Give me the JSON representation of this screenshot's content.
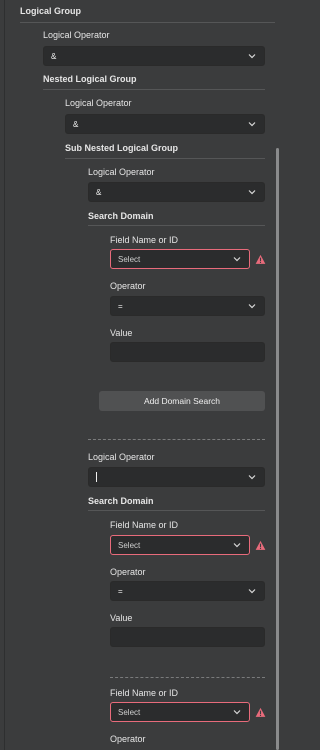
{
  "root": {
    "title": "Logical Group",
    "operator_label": "Logical Operator",
    "operator_value": "&"
  },
  "nested": {
    "title": "Nested Logical Group",
    "operator_label": "Logical Operator",
    "operator_value": "&"
  },
  "sub_nested": {
    "title": "Sub Nested Logical Group",
    "operator_label": "Logical Operator",
    "operator_value": "&",
    "search_domain_title": "Search Domain",
    "domain": {
      "field_label": "Field Name or ID",
      "field_placeholder": "Select",
      "operator_label": "Operator",
      "operator_value": "=",
      "value_label": "Value",
      "value": ""
    },
    "add_button": "Add Domain Search"
  },
  "second_group": {
    "operator_label": "Logical Operator",
    "operator_value": "",
    "search_domain_title": "Search Domain",
    "domain": {
      "field_label": "Field Name or ID",
      "field_placeholder": "Select",
      "operator_label": "Operator",
      "operator_value": "=",
      "value_label": "Value",
      "value": ""
    },
    "domain2": {
      "field_label": "Field Name or ID",
      "field_placeholder": "Select",
      "operator_label": "Operator"
    }
  },
  "colors": {
    "error": "#e86b7b",
    "background": "#3b3c3d",
    "field": "#2b2c2d"
  }
}
